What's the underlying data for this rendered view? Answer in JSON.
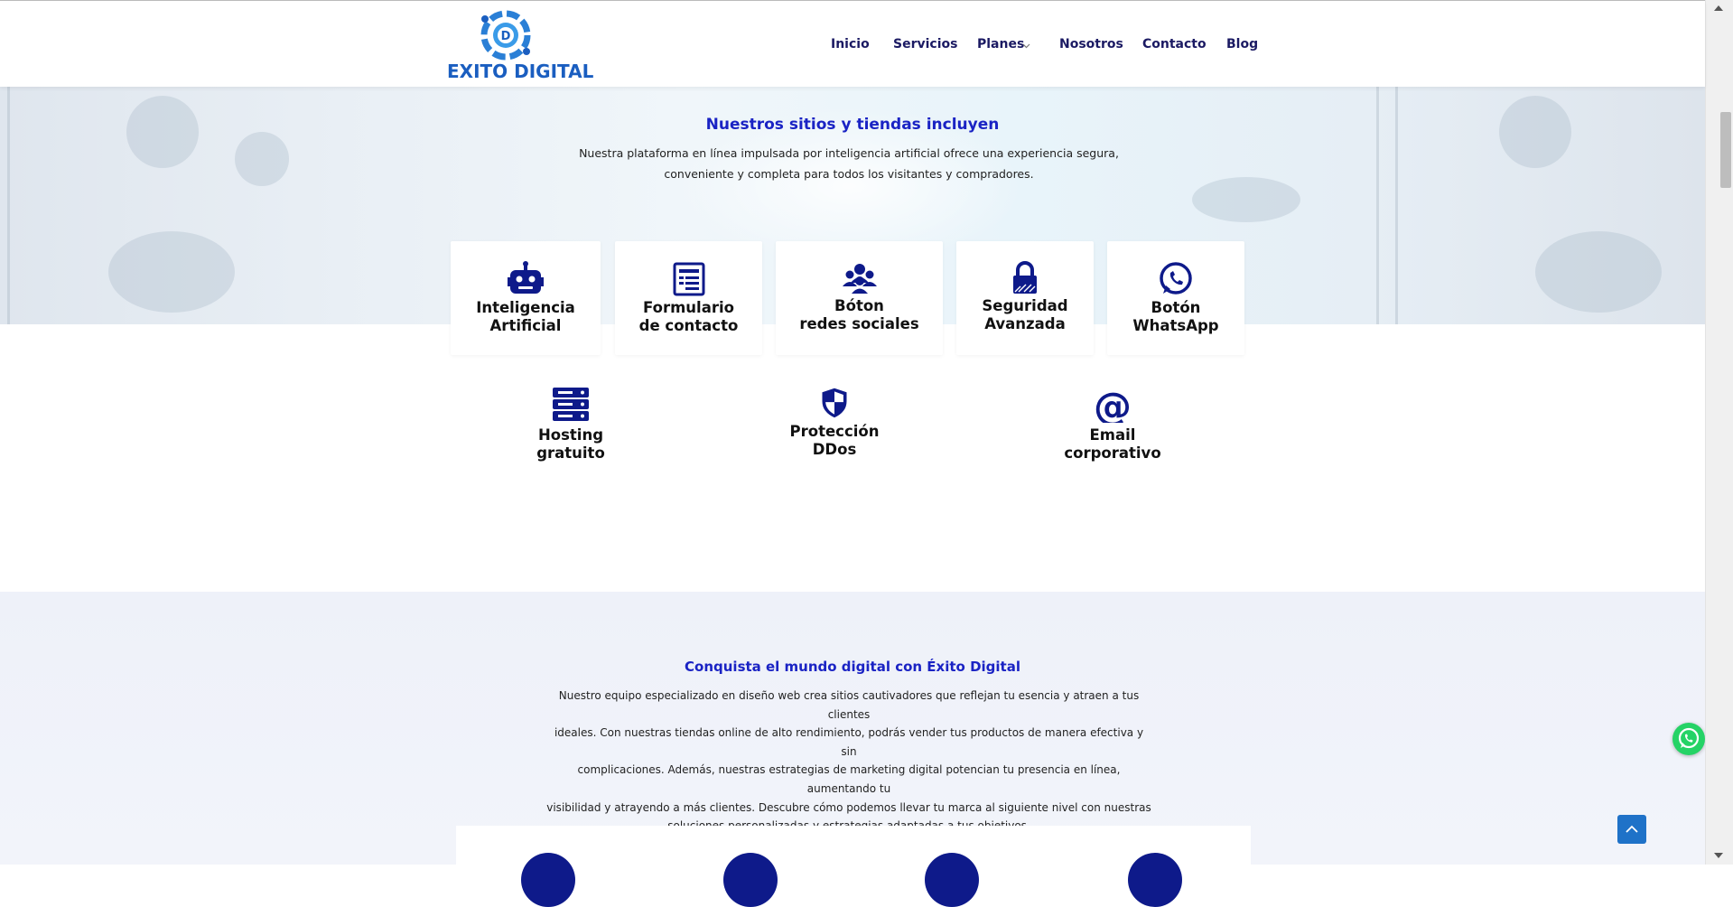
{
  "brand": {
    "logo_text": "EXITO DIGITAL",
    "accent": "#1a23c4",
    "nav_color": "#1b1a63"
  },
  "nav": {
    "items": [
      {
        "label": "Inicio"
      },
      {
        "label": "Servicios"
      },
      {
        "label": "Planes",
        "has_dropdown": true
      },
      {
        "label": "Nosotros"
      },
      {
        "label": "Contacto"
      },
      {
        "label": "Blog"
      }
    ]
  },
  "hero": {
    "title": "Nuestros sitios y tiendas incluyen",
    "desc_line1": "Nuestra plataforma en línea impulsada por inteligencia artificial ofrece una experiencia segura,",
    "desc_line2": "conveniente y completa para todos los visitantes y compradores."
  },
  "features": [
    {
      "line1": "Inteligencia",
      "line2": "Artificial",
      "icon": "robot-icon"
    },
    {
      "line1": "Formulario",
      "line2": "de contacto",
      "icon": "form-icon"
    },
    {
      "line1": "Bóton",
      "line2": "redes sociales",
      "icon": "users-icon"
    },
    {
      "line1": "Seguridad",
      "line2": "Avanzada",
      "icon": "lock-icon"
    },
    {
      "line1": "Botón",
      "line2": "WhatsApp",
      "icon": "whatsapp-icon"
    }
  ],
  "features2": [
    {
      "line1": "Hosting",
      "line2": "gratuito",
      "icon": "server-icon"
    },
    {
      "line1": "Protección",
      "line2": "DDos",
      "icon": "shield-icon"
    },
    {
      "line1": "Email",
      "line2": "corporativo",
      "icon": "at-icon"
    }
  ],
  "section2": {
    "title": "Conquista el mundo digital con Éxito Digital",
    "lines": [
      "Nuestro equipo especializado en diseño web crea sitios cautivadores que reflejan tu esencia y atraen a tus clientes",
      "ideales. Con nuestras tiendas online de alto rendimiento, podrás vender tus productos de manera efectiva y sin",
      "complicaciones. Además, nuestras estrategias de marketing digital potencian tu presencia en línea, aumentando tu",
      "visibilidad y atrayendo a más clientes. Descubre cómo podemos llevar tu marca al siguiente nivel con nuestras",
      "soluciones personalizadas y estrategias adaptadas a tus objetivos."
    ]
  },
  "floating": {
    "whatsapp_color": "#25d366",
    "back_to_top_color": "#1f72c8"
  }
}
